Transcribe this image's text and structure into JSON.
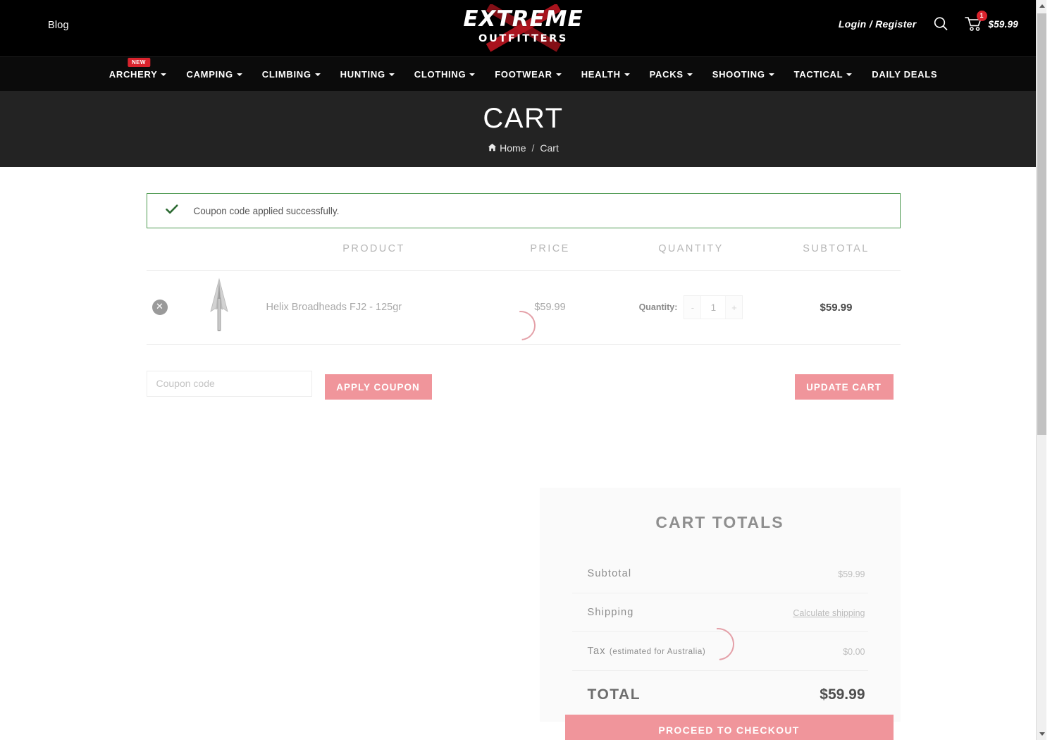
{
  "header": {
    "blog_label": "Blog",
    "logo_main": "EXTREME",
    "logo_sub": "OUTFITTERS",
    "login_label": "Login / Register",
    "search_icon": "search-icon",
    "cart_icon": "cart-icon",
    "cart_count": "1",
    "cart_total": "$59.99"
  },
  "nav": {
    "items": [
      {
        "label": "ARCHERY",
        "has_caret": true,
        "badge": "NEW"
      },
      {
        "label": "CAMPING",
        "has_caret": true,
        "badge": ""
      },
      {
        "label": "CLIMBING",
        "has_caret": true,
        "badge": ""
      },
      {
        "label": "HUNTING",
        "has_caret": true,
        "badge": ""
      },
      {
        "label": "CLOTHING",
        "has_caret": true,
        "badge": ""
      },
      {
        "label": "FOOTWEAR",
        "has_caret": true,
        "badge": ""
      },
      {
        "label": "HEALTH",
        "has_caret": true,
        "badge": ""
      },
      {
        "label": "PACKS",
        "has_caret": true,
        "badge": ""
      },
      {
        "label": "SHOOTING",
        "has_caret": true,
        "badge": ""
      },
      {
        "label": "TACTICAL",
        "has_caret": true,
        "badge": ""
      },
      {
        "label": "DAILY DEALS",
        "has_caret": false,
        "badge": ""
      }
    ]
  },
  "banner": {
    "title": "CART",
    "breadcrumb_home": "Home",
    "breadcrumb_sep": "/",
    "breadcrumb_current": "Cart"
  },
  "notice": {
    "icon": "check-icon",
    "message": "Coupon code applied successfully."
  },
  "cart": {
    "columns": {
      "product": "PRODUCT",
      "price": "PRICE",
      "quantity": "QUANTITY",
      "subtotal": "SUBTOTAL"
    },
    "items": [
      {
        "remove_icon": "remove-item-icon",
        "thumb_icon": "broadhead-arrow-icon",
        "name": "Helix Broadheads FJ2 - 125gr",
        "price": "$59.99",
        "qty_label": "Quantity:",
        "qty_minus": "-",
        "qty_value": "1",
        "qty_plus": "+",
        "subtotal": "$59.99"
      }
    ],
    "coupon_placeholder": "Coupon code",
    "coupon_value": "",
    "apply_coupon_label": "APPLY COUPON",
    "update_cart_label": "UPDATE CART"
  },
  "totals": {
    "title": "CART TOTALS",
    "rows": [
      {
        "label": "Subtotal",
        "sub": "",
        "value": "$59.99",
        "is_link": false
      },
      {
        "label": "Shipping",
        "sub": "",
        "value": "Calculate shipping",
        "is_link": true
      },
      {
        "label": "Tax ",
        "sub": "(estimated for Australia)",
        "value": "$0.00",
        "is_link": false
      }
    ],
    "total_label": "TOTAL",
    "total_value": "$59.99",
    "checkout_label": "PROCEED TO CHECKOUT"
  },
  "colors": {
    "accent_pink": "#f0959b",
    "header_black": "#000000",
    "banner_dark": "#232323",
    "badge_red": "#d9232d",
    "success_green": "#4e9a51"
  }
}
